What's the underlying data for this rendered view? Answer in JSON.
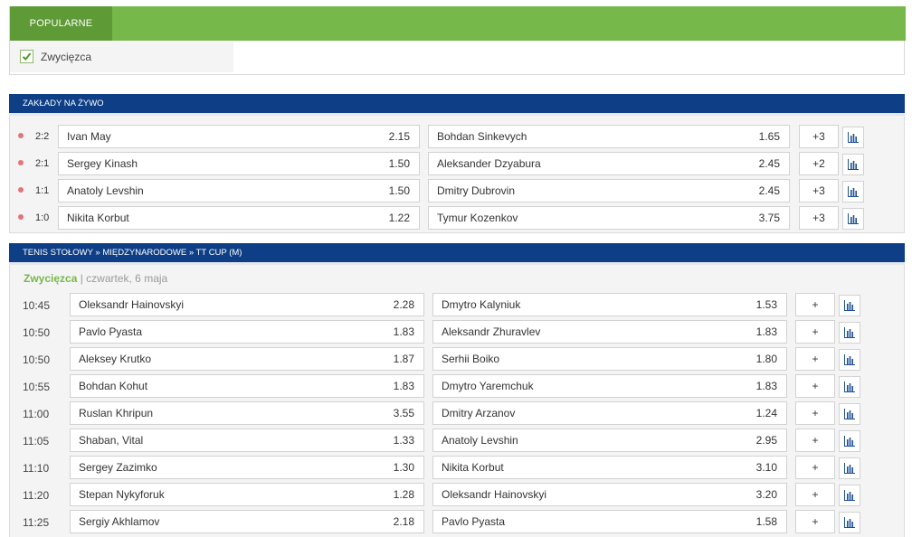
{
  "popular": {
    "tab_label": "POPULARNE",
    "filter_label": "Zwycięzca",
    "filter_checked": true
  },
  "live": {
    "title": "ZAKŁADY NA ŻYWO",
    "rows": [
      {
        "score": "2:2",
        "home": "Ivan May",
        "home_odd": "2.15",
        "away": "Bohdan Sinkevych",
        "away_odd": "1.65",
        "more": "+3"
      },
      {
        "score": "2:1",
        "home": "Sergey Kinash",
        "home_odd": "1.50",
        "away": "Aleksander Dzyabura",
        "away_odd": "2.45",
        "more": "+2"
      },
      {
        "score": "1:1",
        "home": "Anatoly Levshin",
        "home_odd": "1.50",
        "away": "Dmitry Dubrovin",
        "away_odd": "2.45",
        "more": "+3"
      },
      {
        "score": "1:0",
        "home": "Nikita Korbut",
        "home_odd": "1.22",
        "away": "Tymur Kozenkov",
        "away_odd": "3.75",
        "more": "+3"
      }
    ]
  },
  "cup": {
    "title": "TENIS STOŁOWY » MIĘDZYNARODOWE » TT CUP (M)",
    "market_label": "Zwycięzca",
    "separator": " | ",
    "date_label": "czwartek, 6 maja",
    "rows": [
      {
        "time": "10:45",
        "home": "Oleksandr Hainovskyi",
        "home_odd": "2.28",
        "away": "Dmytro Kalyniuk",
        "away_odd": "1.53",
        "more": "+"
      },
      {
        "time": "10:50",
        "home": "Pavlo Pyasta",
        "home_odd": "1.83",
        "away": "Aleksandr Zhuravlev",
        "away_odd": "1.83",
        "more": "+"
      },
      {
        "time": "10:50",
        "home": "Aleksey Krutko",
        "home_odd": "1.87",
        "away": "Serhii Boiko",
        "away_odd": "1.80",
        "more": "+"
      },
      {
        "time": "10:55",
        "home": "Bohdan Kohut",
        "home_odd": "1.83",
        "away": "Dmytro Yaremchuk",
        "away_odd": "1.83",
        "more": "+"
      },
      {
        "time": "11:00",
        "home": "Ruslan Khripun",
        "home_odd": "3.55",
        "away": "Dmitry Arzanov",
        "away_odd": "1.24",
        "more": "+"
      },
      {
        "time": "11:05",
        "home": "Shaban, Vital",
        "home_odd": "1.33",
        "away": "Anatoly Levshin",
        "away_odd": "2.95",
        "more": "+"
      },
      {
        "time": "11:10",
        "home": "Sergey Zazimko",
        "home_odd": "1.30",
        "away": "Nikita Korbut",
        "away_odd": "3.10",
        "more": "+"
      },
      {
        "time": "11:20",
        "home": "Stepan Nykyforuk",
        "home_odd": "1.28",
        "away": "Oleksandr Hainovskyi",
        "away_odd": "3.20",
        "more": "+"
      },
      {
        "time": "11:25",
        "home": "Sergiy Akhlamov",
        "home_odd": "2.18",
        "away": "Pavlo Pyasta",
        "away_odd": "1.58",
        "more": "+"
      }
    ]
  },
  "colors": {
    "green_bar": "#76b84a",
    "green_tab": "#5e9a35",
    "navy_header": "#0e3f86",
    "live_dot": "#e0757a",
    "stats_icon": "#1f4f96"
  },
  "icons": {
    "checkbox": "checkmark-icon",
    "stats": "bar-chart-icon",
    "live": "live-dot-icon"
  }
}
